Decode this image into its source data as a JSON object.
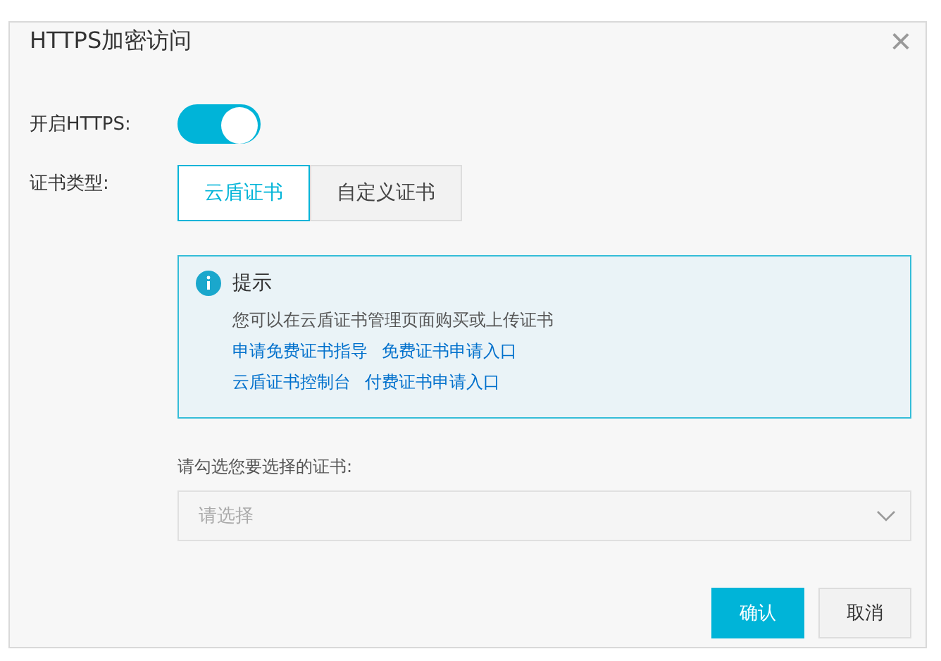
{
  "dialog": {
    "title": "HTTPS加密访问",
    "close": "×"
  },
  "https": {
    "label": "开启HTTPS:",
    "on": true
  },
  "cert_type": {
    "label": "证书类型:",
    "tabs": [
      {
        "label": "云盾证书",
        "selected": true
      },
      {
        "label": "自定义证书",
        "selected": false
      }
    ]
  },
  "notice": {
    "title": "提示",
    "text": "您可以在云盾证书管理页面购买或上传证书",
    "links": [
      [
        "申请免费证书指导",
        "免费证书申请入口"
      ],
      [
        "云盾证书控制台",
        "付费证书申请入口"
      ]
    ]
  },
  "select": {
    "label": "请勾选您要选择的证书:",
    "placeholder": "请选择"
  },
  "buttons": [
    {
      "label": "确认",
      "kind": "primary"
    },
    {
      "label": "取消",
      "kind": "secondary"
    }
  ]
}
